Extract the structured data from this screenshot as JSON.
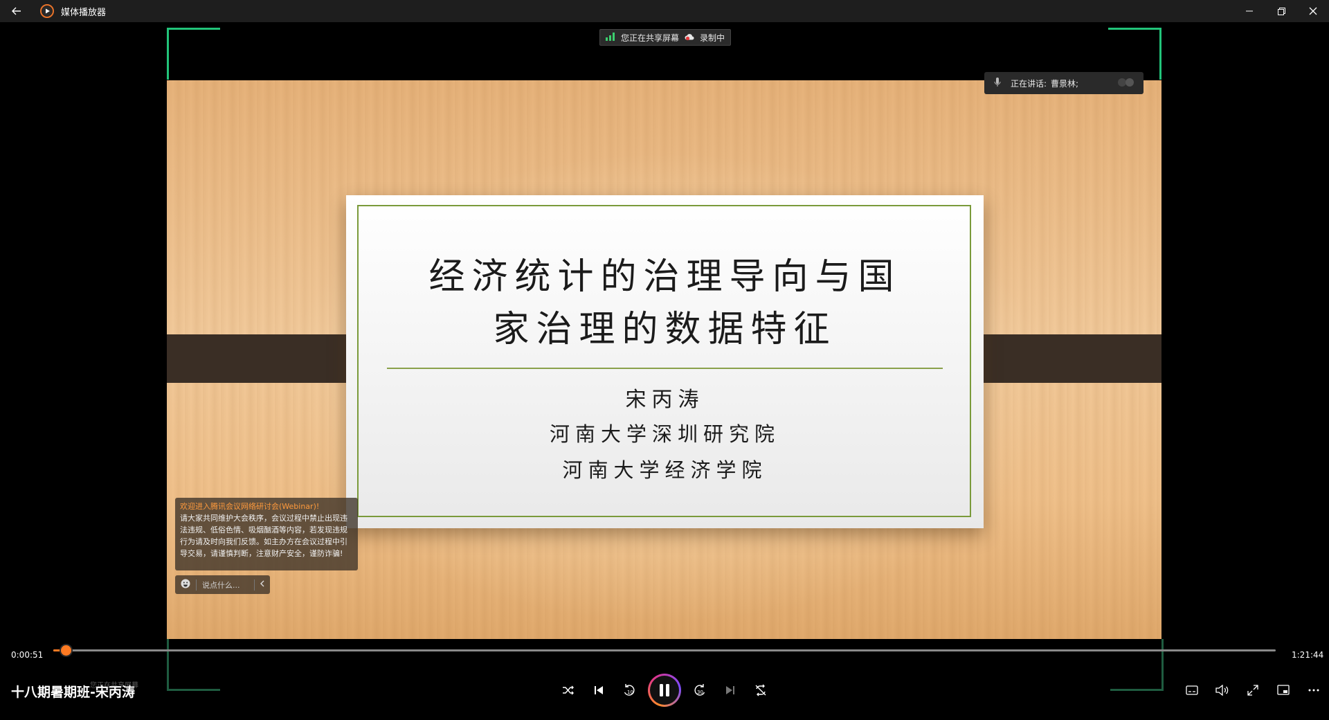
{
  "window": {
    "app_title": "媒体播放器",
    "icon_names": [
      "back-arrow-icon",
      "media-player-icon",
      "minimize-icon",
      "restore-icon",
      "close-icon"
    ]
  },
  "video": {
    "share_indicator": {
      "sharing_label": "您正在共享屏幕",
      "recording_label": "录制中"
    },
    "speaking_indicator": {
      "label": "正在讲话:",
      "speaker": "曹景林;"
    },
    "slide": {
      "title_line1": "经济统计的治理导向与国",
      "title_line2": "家治理的数据特征",
      "author": "宋丙涛",
      "affiliation1": "河南大学深圳研究院",
      "affiliation2": "河南大学经济学院"
    },
    "meeting_notice": {
      "title": "欢迎进入腾讯会议网络研讨会(Webinar)!",
      "body": "请大家共同维护大会秩序，会议过程中禁止出现违法违规、低俗色情、吸烟酗酒等内容，若发现违规行为请及时向我们反馈。如主办方在会议过程中引导交易，请谨慎判断，注意财产安全，谨防诈骗!"
    },
    "chat_placeholder": "说点什么...",
    "colors": {
      "bracket_green": "#22c47a",
      "notice_title": "#ff9a3c",
      "slide_border": "#7a9a3a"
    }
  },
  "player": {
    "current_time": "0:00:51",
    "total_time": "1:21:44",
    "progress_fraction": 0.0104,
    "media_title": "十八期暑期班-宋丙涛",
    "ghost_caption": "您正在共享屏幕",
    "accent_color": "#ff7a22",
    "controls": [
      "shuffle-icon",
      "previous-icon",
      "rewind-10-icon",
      "pause-icon",
      "forward-30-icon",
      "next-icon",
      "repeat-off-icon"
    ],
    "right_controls": [
      "captions-icon",
      "volume-icon",
      "fullscreen-icon",
      "mini-view-icon",
      "more-icon"
    ]
  }
}
